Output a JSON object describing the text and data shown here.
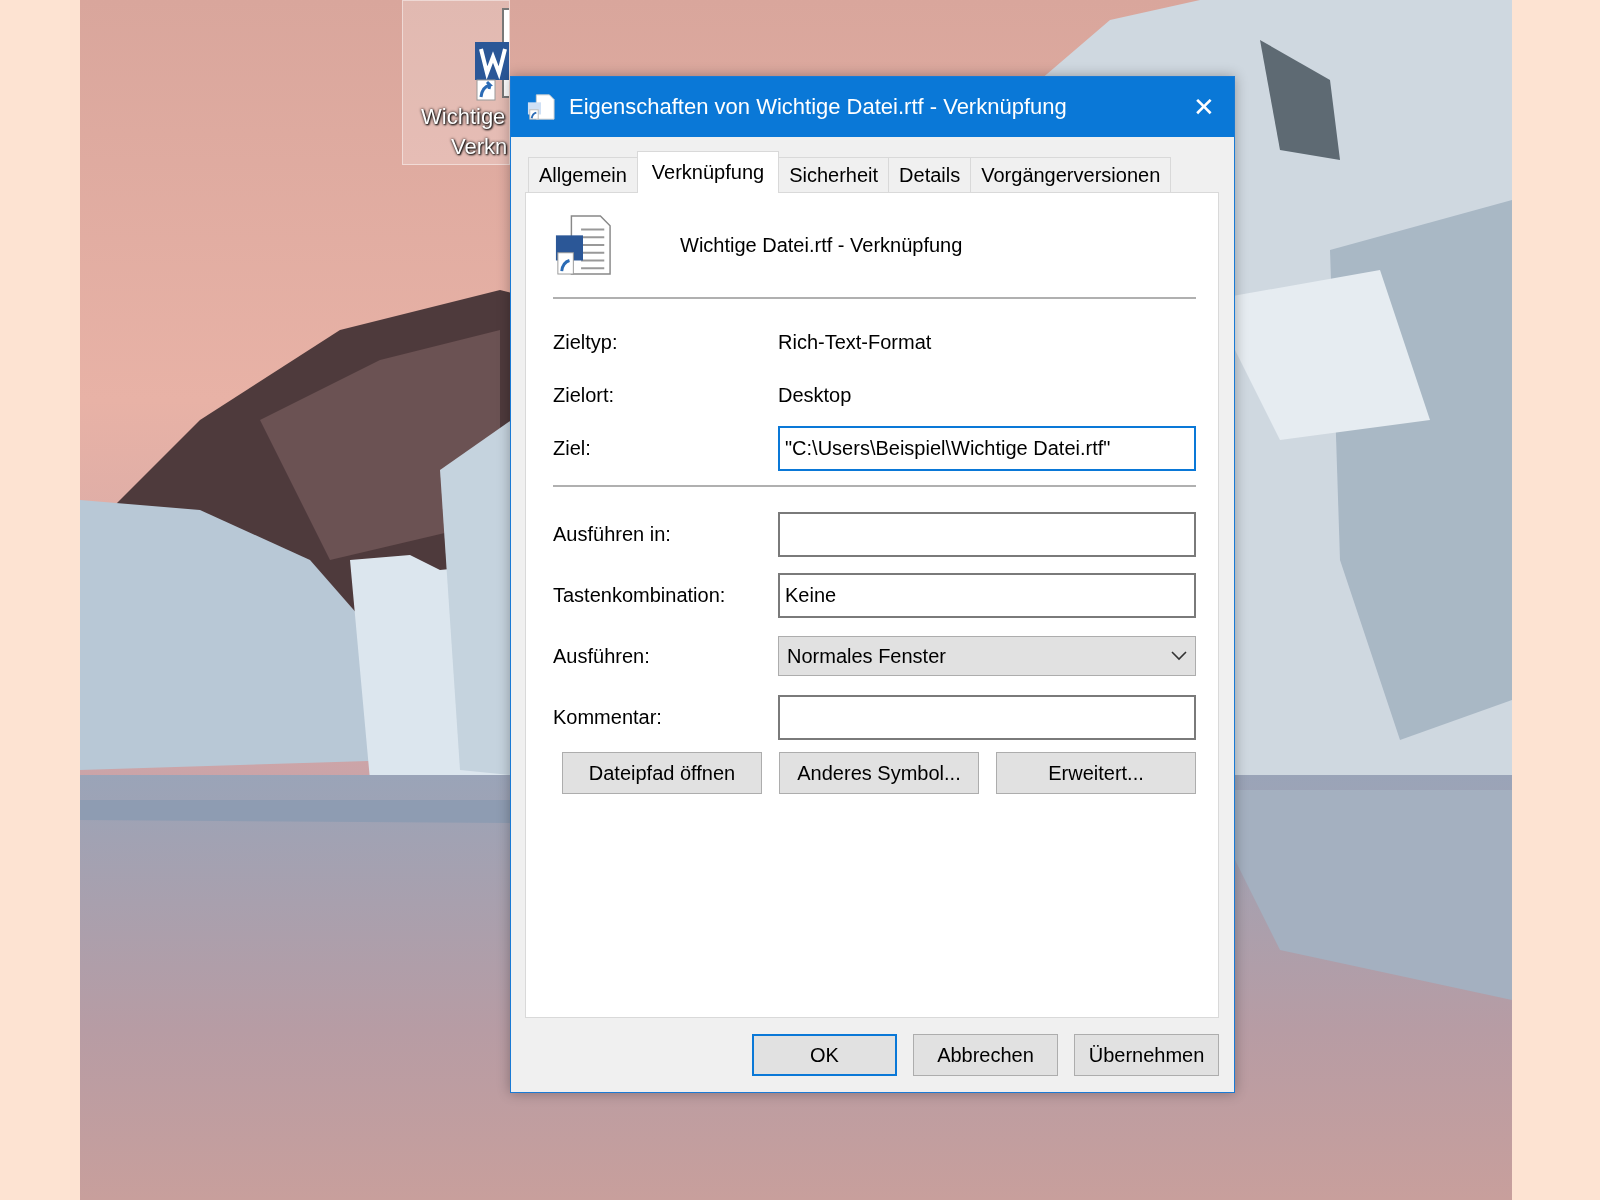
{
  "desktop_icon": {
    "label_lines": [
      "Wichtige",
      "Verkn"
    ],
    "selected": true
  },
  "dialog": {
    "title": "Eigenschaften von Wichtige Datei.rtf - Verknüpfung",
    "close": "✕",
    "tabs": [
      {
        "label": "Allgemein",
        "selected": false
      },
      {
        "label": "Verknüpfung",
        "selected": true
      },
      {
        "label": "Sicherheit",
        "selected": false
      },
      {
        "label": "Details",
        "selected": false
      },
      {
        "label": "Vorgängerversionen",
        "selected": false
      }
    ],
    "file_name": "Wichtige Datei.rtf - Verknüpfung",
    "groups": [
      [
        {
          "kind": "text",
          "label": "Zieltyp:",
          "value": "Rich-Text-Format"
        },
        {
          "kind": "text",
          "label": "Zielort:",
          "value": "Desktop"
        },
        {
          "kind": "input",
          "label": "Ziel:",
          "value": "\"C:\\Users\\Beispiel\\Wichtige Datei.rtf\"",
          "focused": true
        }
      ],
      [
        {
          "kind": "input",
          "label": "Ausführen in:",
          "focused": false
        },
        {
          "kind": "input",
          "label": "Tastenkombination:",
          "value": "Keine",
          "focused": false
        },
        {
          "kind": "select",
          "label": "Ausführen:",
          "value": "Normales Fenster"
        },
        {
          "kind": "input",
          "label": "Kommentar:",
          "focused": false
        }
      ]
    ],
    "actions": [
      "Dateipfad öffnen",
      "Anderes Symbol...",
      "Erweitert..."
    ],
    "buttons": [
      {
        "label": "OK",
        "default": true
      },
      {
        "label": "Abbrechen",
        "default": false
      },
      {
        "label": "Übernehmen",
        "default": false
      }
    ]
  }
}
